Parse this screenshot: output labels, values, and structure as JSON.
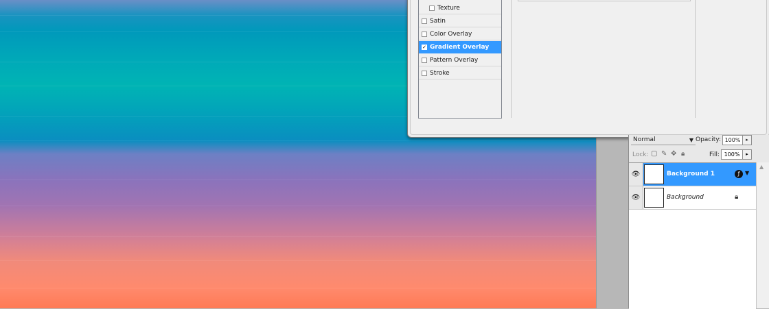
{
  "layer_style_dialog": {
    "styles": [
      {
        "label": "Texture",
        "checked": false,
        "sub": true
      },
      {
        "label": "Satin",
        "checked": false,
        "sub": false
      },
      {
        "label": "Color Overlay",
        "checked": false,
        "sub": false
      },
      {
        "label": "Gradient Overlay",
        "checked": true,
        "sub": false,
        "selected": true
      },
      {
        "label": "Pattern Overlay",
        "checked": false,
        "sub": false
      },
      {
        "label": "Stroke",
        "checked": false,
        "sub": false
      }
    ],
    "check_mark": "✓"
  },
  "layers_panel": {
    "blend_mode": "Normal",
    "opacity_label": "Opacity:",
    "opacity_value": "100%",
    "lock_label": "Lock:",
    "fill_label": "Fill:",
    "fill_value": "100%",
    "layers": [
      {
        "name": "Background 1",
        "selected": true,
        "has_fx": true
      },
      {
        "name": "Background",
        "selected": false,
        "locked": true
      }
    ]
  },
  "colors": {
    "selection": "#3399ff",
    "gradient_top": "#0099bb",
    "gradient_bottom": "#ff7a55"
  }
}
